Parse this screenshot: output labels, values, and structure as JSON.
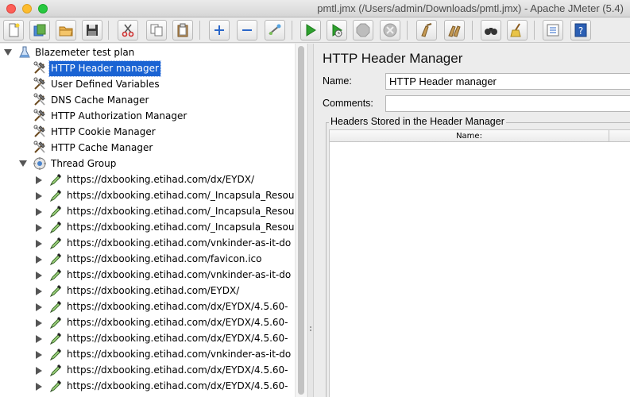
{
  "window": {
    "title": "pmtl.jmx (/Users/admin/Downloads/pmtl.jmx) - Apache JMeter (5.4)"
  },
  "toolbar": {
    "buttons": [
      {
        "name": "new-icon"
      },
      {
        "name": "templates-icon"
      },
      {
        "name": "open-icon"
      },
      {
        "name": "save-icon"
      },
      {
        "name": "cut-icon"
      },
      {
        "name": "copy-icon"
      },
      {
        "name": "paste-icon"
      },
      {
        "name": "expand-icon"
      },
      {
        "name": "collapse-icon"
      },
      {
        "name": "toggle-icon"
      },
      {
        "name": "start-icon"
      },
      {
        "name": "start-no-timers-icon"
      },
      {
        "name": "stop-icon"
      },
      {
        "name": "shutdown-icon"
      },
      {
        "name": "clear-icon"
      },
      {
        "name": "clear-all-icon"
      },
      {
        "name": "search-icon"
      },
      {
        "name": "reset-search-icon"
      },
      {
        "name": "function-helper-icon"
      },
      {
        "name": "help-icon"
      }
    ]
  },
  "tree": {
    "root": "Blazemeter test plan",
    "config_items": [
      "HTTP Header manager",
      "User Defined Variables",
      "DNS Cache Manager",
      "HTTP Authorization Manager",
      "HTTP Cookie Manager",
      "HTTP Cache Manager"
    ],
    "selected_index": 0,
    "thread_group": "Thread Group",
    "samplers": [
      "https://dxbooking.etihad.com/dx/EYDX/",
      "https://dxbooking.etihad.com/_Incapsula_Resour",
      "https://dxbooking.etihad.com/_Incapsula_Resour",
      "https://dxbooking.etihad.com/_Incapsula_Resour",
      "https://dxbooking.etihad.com/vnkinder-as-it-do",
      "https://dxbooking.etihad.com/favicon.ico",
      "https://dxbooking.etihad.com/vnkinder-as-it-do",
      "https://dxbooking.etihad.com/EYDX/",
      "https://dxbooking.etihad.com/dx/EYDX/4.5.60-",
      "https://dxbooking.etihad.com/dx/EYDX/4.5.60-",
      "https://dxbooking.etihad.com/dx/EYDX/4.5.60-",
      "https://dxbooking.etihad.com/vnkinder-as-it-do",
      "https://dxbooking.etihad.com/dx/EYDX/4.5.60-",
      "https://dxbooking.etihad.com/dx/EYDX/4.5.60-"
    ]
  },
  "editor": {
    "title": "HTTP Header Manager",
    "name_label": "Name:",
    "name_value": "HTTP Header manager",
    "comments_label": "Comments:",
    "comments_value": "",
    "group_title": "Headers Stored in the Header Manager",
    "table_columns": [
      "Name:"
    ]
  },
  "colors": {
    "selection": "#1a63d3",
    "tree_background": "#ffffff",
    "panel_background": "#ececec"
  }
}
